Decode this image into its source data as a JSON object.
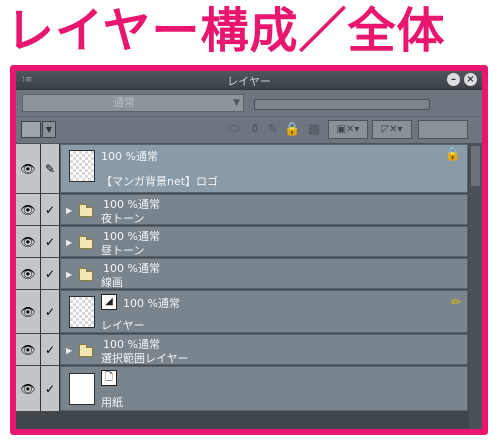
{
  "heading": "レイヤー構成／全体",
  "panel": {
    "title": "レイヤー",
    "grip_icon": "grip-icon",
    "blend_mode": "通常",
    "colors": {
      "accent": "#e8166e",
      "panel_bg": "#5e6870",
      "layer_bg": "#79848d"
    }
  },
  "layers": [
    {
      "opacity_mode": "100 %通常",
      "name": "【マンガ背景net】ロゴ",
      "type": "raster",
      "locked": true,
      "selected": true,
      "edit_icon": "pen-edit-icon"
    },
    {
      "opacity_mode": "100 %通常",
      "name": "夜トーン",
      "type": "folder"
    },
    {
      "opacity_mode": "100 %通常",
      "name": "昼トーン",
      "type": "folder"
    },
    {
      "opacity_mode": "100 %通常",
      "name": "線画",
      "type": "folder"
    },
    {
      "opacity_mode": "100 %通常",
      "name": "レイヤー",
      "type": "vector",
      "pen_marker": true
    },
    {
      "opacity_mode": "100 %通常",
      "name": "選択範囲レイヤー",
      "type": "folder"
    },
    {
      "opacity_mode": "",
      "name": "用紙",
      "type": "paper"
    }
  ]
}
